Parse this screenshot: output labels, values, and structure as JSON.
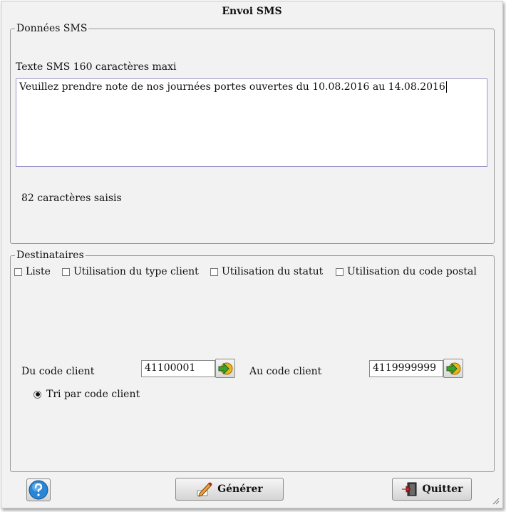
{
  "window": {
    "title": "Envoi SMS"
  },
  "sms": {
    "legend": "Données SMS",
    "label": "Texte SMS 160 caractères maxi",
    "text": "Veuillez prendre note de nos journées portes ouvertes du 10.08.2016 au 14.08.2016",
    "count": "82 caractères saisis"
  },
  "recipients": {
    "legend": "Destinataires",
    "options": [
      {
        "label": "Liste",
        "checked": false
      },
      {
        "label": "Utilisation du type client",
        "checked": false
      },
      {
        "label": "Utilisation du statut",
        "checked": false
      },
      {
        "label": "Utilisation du code postal",
        "checked": false
      }
    ],
    "from_label": "Du code client",
    "from_value": "41100001",
    "to_label": "Au code client",
    "to_value": "4119999999",
    "sort_label": "Tri par code client",
    "sort_selected": true
  },
  "buttons": {
    "generate": "Générer",
    "quit": "Quitter"
  },
  "icons": {
    "help": "help-icon",
    "go": "arrow-right-icon",
    "generate": "pencil-icon",
    "quit": "exit-door-icon"
  }
}
